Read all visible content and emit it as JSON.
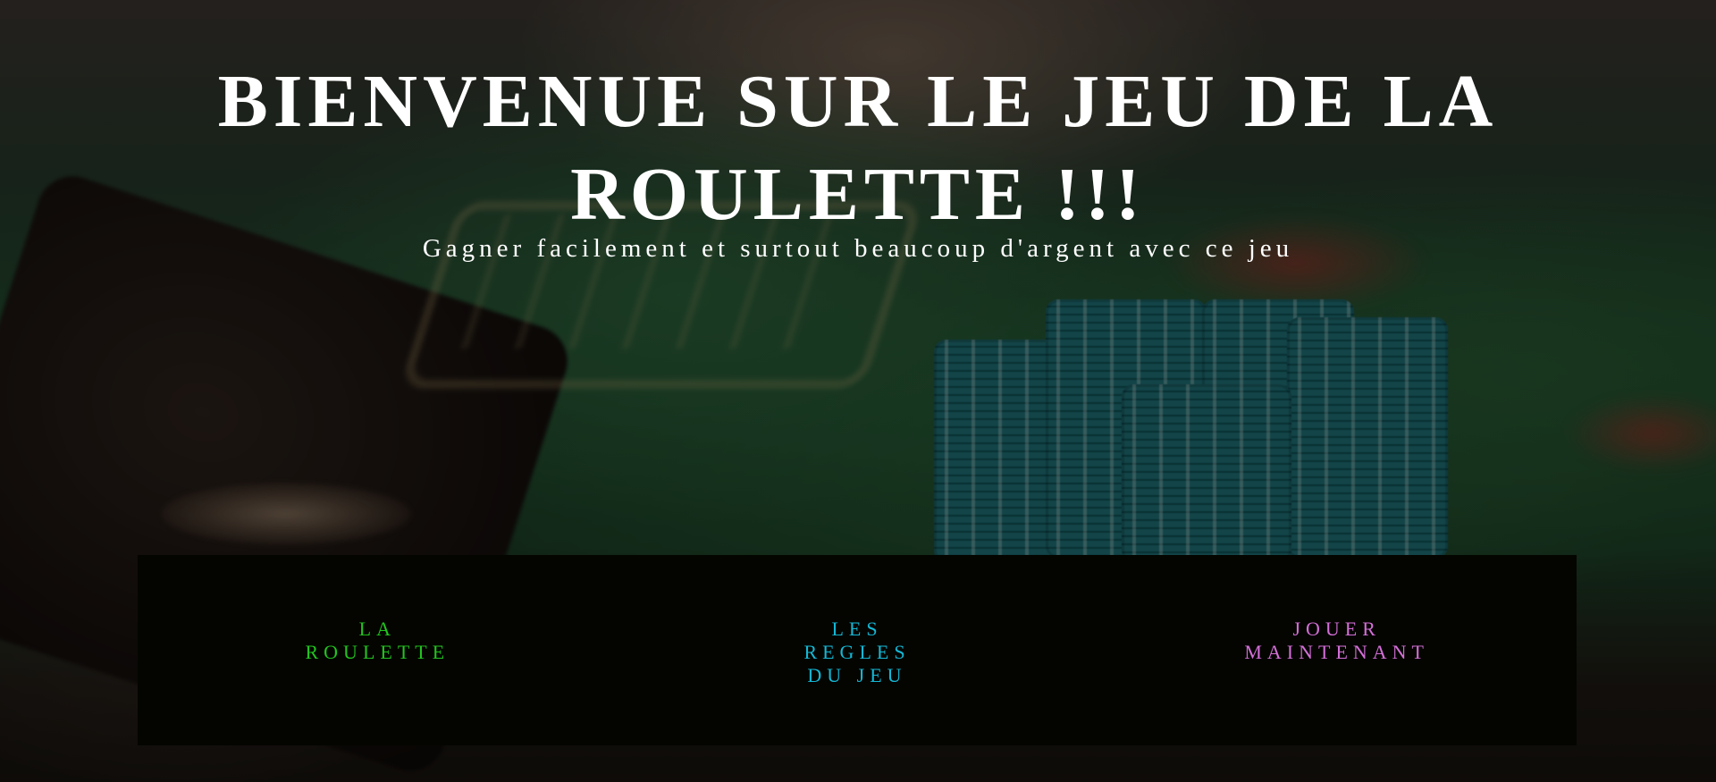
{
  "hero": {
    "title": "BIENVENUE SUR LE JEU DE LA ROULETTE !!!",
    "subtitle": "Gagner facilement et surtout beaucoup d'argent avec ce jeu"
  },
  "menu": {
    "items": [
      {
        "label": "LA ROULETTE",
        "color": "#22c41f"
      },
      {
        "label": "LES REGLES DU JEU",
        "color": "#14b8d6"
      },
      {
        "label": "JOUER MAINTENANT",
        "color": "#d46fd8"
      }
    ]
  }
}
